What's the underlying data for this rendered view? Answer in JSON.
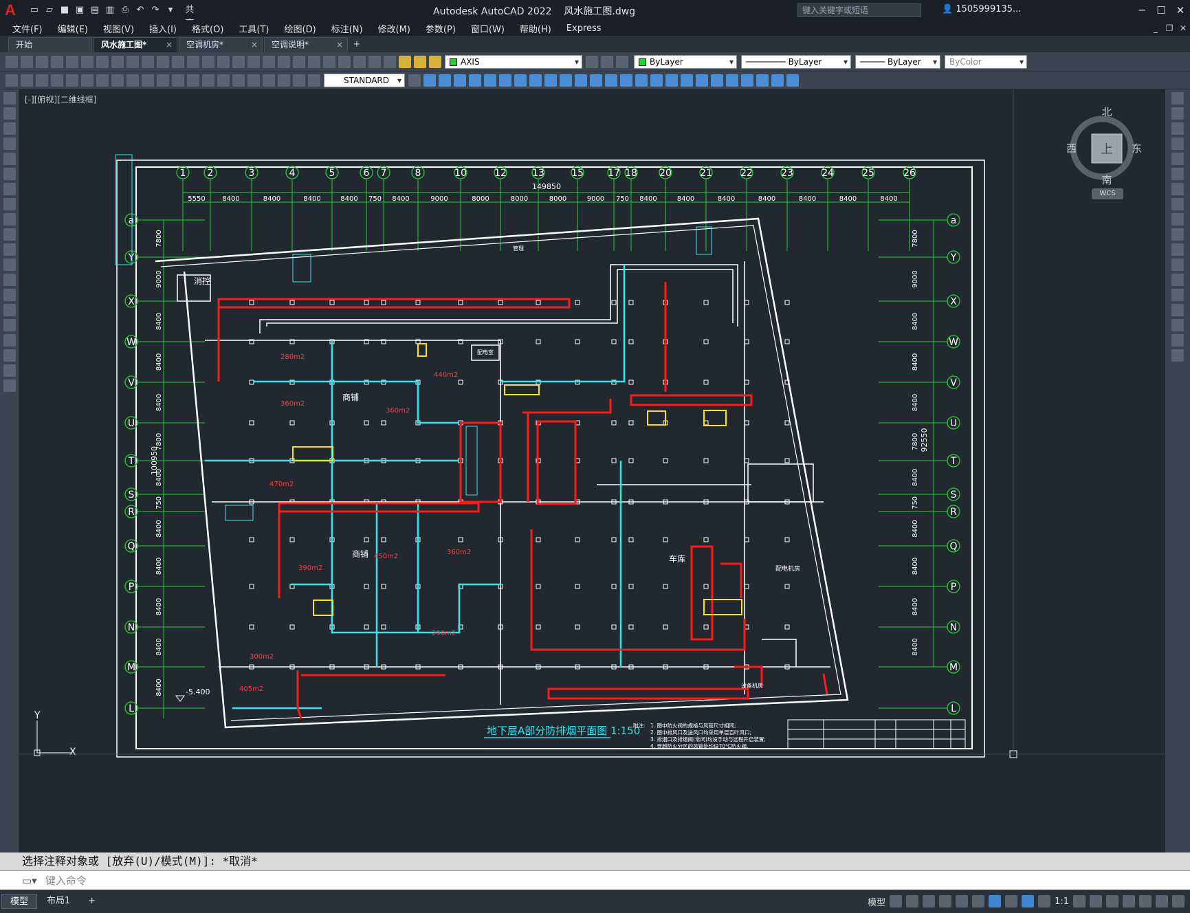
{
  "app": {
    "logo_letter": "A",
    "title": "Autodesk AutoCAD 2022    风水施工图.dwg",
    "share_label": "共享",
    "search_placeholder": "键入关键字或短语",
    "user": "1505999135...",
    "window_controls": [
      "─",
      "☐",
      "✕"
    ]
  },
  "menu": [
    "文件(F)",
    "编辑(E)",
    "视图(V)",
    "插入(I)",
    "格式(O)",
    "工具(T)",
    "绘图(D)",
    "标注(N)",
    "修改(M)",
    "参数(P)",
    "窗口(W)",
    "帮助(H)",
    "Express"
  ],
  "tabs": [
    {
      "label": "开始",
      "active": false,
      "closable": false
    },
    {
      "label": "风水施工图*",
      "active": true,
      "closable": true
    },
    {
      "label": "空调机房*",
      "active": false,
      "closable": true
    },
    {
      "label": "空调说明*",
      "active": false,
      "closable": true
    }
  ],
  "toolbar": {
    "layer": "AXIS",
    "layer_color": "#21d32b",
    "color": "ByLayer",
    "linetype": "ByLayer",
    "lineweight": "ByLayer",
    "plotstyle": "ByColor",
    "textstyle": "STANDARD"
  },
  "viewport": {
    "label": "[-][俯视][二维线框]",
    "viewcube": {
      "north": "北",
      "south": "南",
      "east": "东",
      "west": "西",
      "top": "上",
      "wcs": "WCS"
    },
    "ucs": {
      "x": "X",
      "y": "Y"
    }
  },
  "drawing": {
    "grid_top": [
      "1",
      "2",
      "3",
      "4",
      "5",
      "6",
      "7",
      "8",
      "10",
      "12",
      "13",
      "15",
      "17",
      "18",
      "20",
      "21",
      "22",
      "23",
      "24",
      "25",
      "26"
    ],
    "grid_side": [
      "a",
      "Y",
      "X",
      "W",
      "V",
      "U",
      "T",
      "S",
      "R",
      "Q",
      "P",
      "N",
      "M",
      "L"
    ],
    "dims_top": [
      "5550",
      "8400",
      "8400",
      "8400",
      "8400",
      "750",
      "8400",
      "9000",
      "8000",
      "8000",
      "8000",
      "9000",
      "750",
      "8400",
      "8400",
      "8400",
      "8400",
      "8400",
      "8400",
      "8400"
    ],
    "total_width": "149850",
    "total_height_left": "100950",
    "total_height_right": "92550",
    "dims_left": [
      "7800",
      "9000",
      "8400",
      "8400",
      "8400",
      "7800",
      "8400",
      "750",
      "8400",
      "8400",
      "8400",
      "8400",
      "8400"
    ],
    "rooms": {
      "xiaokong": "消控",
      "shangpu1": "商铺",
      "shangpu2": "商铺",
      "cheku": "车库",
      "peidian": "配电室",
      "guanli": "管理",
      "jifang": "配电机房",
      "shebei": "设备机房"
    },
    "areas": [
      "280m2",
      "360m2",
      "440m2",
      "360m2",
      "470m2",
      "450m2",
      "360m2",
      "390m2",
      "290m2",
      "300m2",
      "405m2"
    ],
    "elevation": "-5.400",
    "plan_title": "地下层A部分防排烟平面图 1:150",
    "notes_head": "附注:",
    "notes": [
      "1. 图中防火阀的规格与风管尺寸相同;",
      "2. 图中排风口及送风口均采用单层百叶风口;",
      "3. 排烟口及排烟阀(常闭)均设手动与远程开启装置;",
      "4. 穿越防火分区的风管处均设70℃防火阀."
    ]
  },
  "command": {
    "history": "选择注释对象或 [放弃(U)/模式(M)]: *取消*",
    "placeholder": "键入命令"
  },
  "status": {
    "tabs": [
      {
        "label": "模型",
        "active": true
      },
      {
        "label": "布局1",
        "active": false
      }
    ],
    "model_label": "模型",
    "scale": "1:1"
  }
}
